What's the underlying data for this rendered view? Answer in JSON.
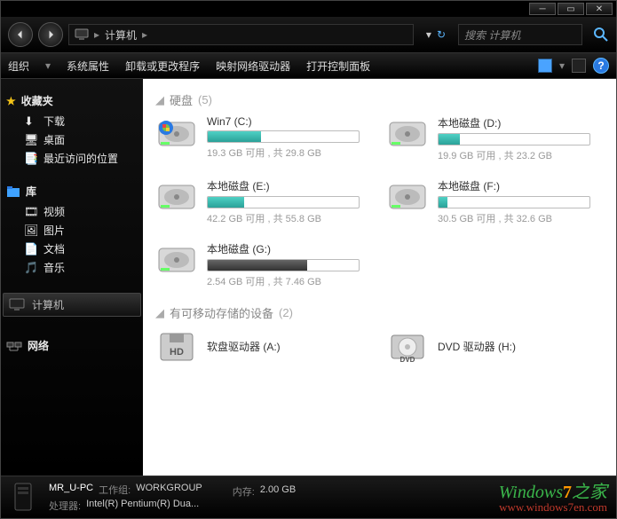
{
  "breadcrumb": {
    "root_icon": "computer-icon",
    "root_label": "计算机"
  },
  "search": {
    "placeholder": "搜索 计算机"
  },
  "toolbar": {
    "organize": "组织",
    "sysprops": "系统属性",
    "uninstall": "卸载或更改程序",
    "mapdrive": "映射网络驱动器",
    "controlpanel": "打开控制面板"
  },
  "sidebar": {
    "favorites_label": "收藏夹",
    "favorites": [
      {
        "label": "下载",
        "icon": "download-icon"
      },
      {
        "label": "桌面",
        "icon": "desktop-icon"
      },
      {
        "label": "最近访问的位置",
        "icon": "recent-icon"
      }
    ],
    "libraries_label": "库",
    "libraries": [
      {
        "label": "视频",
        "icon": "video-icon"
      },
      {
        "label": "图片",
        "icon": "picture-icon"
      },
      {
        "label": "文档",
        "icon": "document-icon"
      },
      {
        "label": "音乐",
        "icon": "music-icon"
      }
    ],
    "computer_label": "计算机",
    "network_label": "网络"
  },
  "groups": {
    "hdd_label": "硬盘",
    "hdd_count": "(5)",
    "removable_label": "有可移动存储的设备",
    "removable_count": "(2)"
  },
  "drives": [
    {
      "name": "Win7 (C:)",
      "free": "19.3 GB 可用 , 共 29.8 GB",
      "fill_pct": 35,
      "style": "teal",
      "os": true
    },
    {
      "name": "本地磁盘 (D:)",
      "free": "19.9 GB 可用 , 共 23.2 GB",
      "fill_pct": 14,
      "style": "teal",
      "os": false
    },
    {
      "name": "本地磁盘 (E:)",
      "free": "42.2 GB 可用 , 共 55.8 GB",
      "fill_pct": 24,
      "style": "teal",
      "os": false
    },
    {
      "name": "本地磁盘 (F:)",
      "free": "30.5 GB 可用 , 共 32.6 GB",
      "fill_pct": 6,
      "style": "teal",
      "os": false
    },
    {
      "name": "本地磁盘 (G:)",
      "free": "2.54 GB 可用 , 共 7.46 GB",
      "fill_pct": 66,
      "style": "dark",
      "os": false
    }
  ],
  "removable": [
    {
      "name": "软盘驱动器 (A:)",
      "icon": "floppy-icon"
    },
    {
      "name": "DVD 驱动器 (H:)",
      "icon": "dvd-icon"
    }
  ],
  "status": {
    "pcname": "MR_U-PC",
    "workgroup_label": "工作组:",
    "workgroup": "WORKGROUP",
    "cpu_label": "处理器:",
    "cpu": "Intel(R) Pentium(R) Dua...",
    "mem_label": "内存:",
    "mem": "2.00 GB"
  },
  "watermark": {
    "line1_a": "Windows",
    "line1_b": "7",
    "line1_c": "之家",
    "line2": "www.windows7en.com"
  }
}
